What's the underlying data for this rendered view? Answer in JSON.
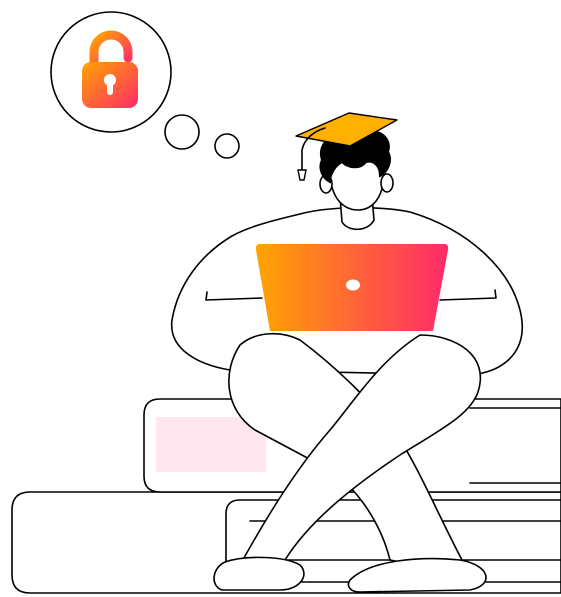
{
  "illustration": {
    "subject": "student-with-laptop",
    "thought_icon": "lock-icon",
    "colors": {
      "accent_orange": "#ffa400",
      "accent_pink": "#ff2a6a",
      "cap_yellow": "#ffb000",
      "book_tint": "#ffe6ef",
      "outline": "#000000",
      "background": "#ffffff"
    }
  }
}
